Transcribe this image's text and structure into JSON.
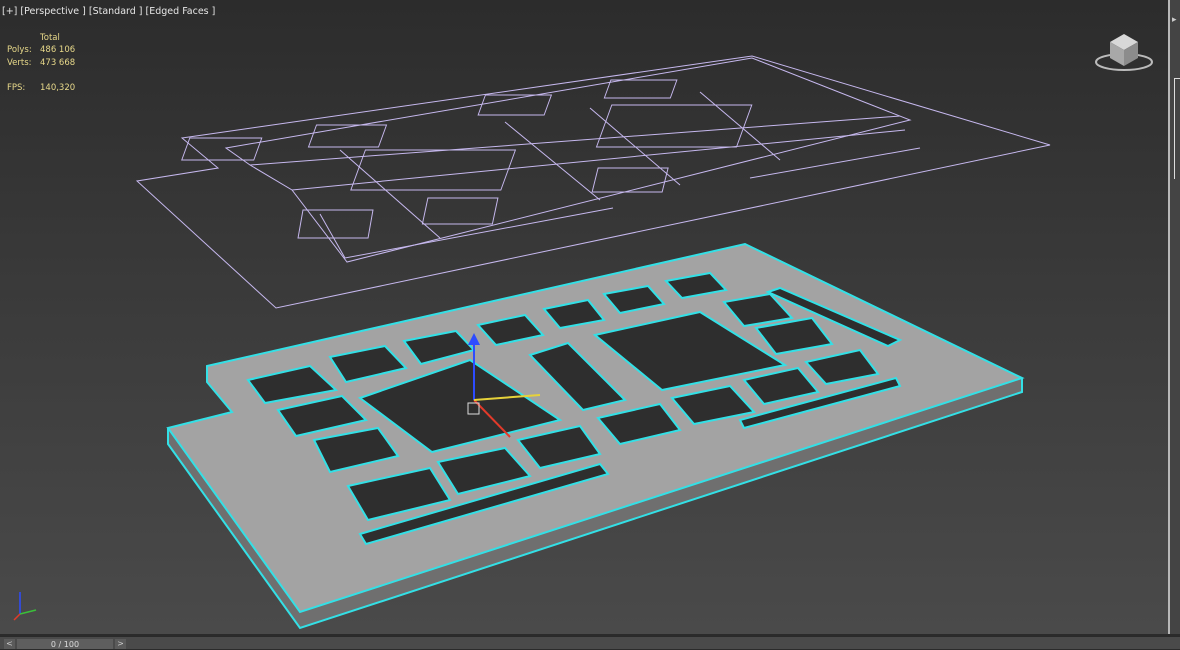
{
  "viewport": {
    "label": "[+] [Perspective ] [Standard ] [Edged Faces ]"
  },
  "stats": {
    "header": "Total",
    "polys_label": "Polys:",
    "polys_value": "486 106",
    "verts_label": "Verts:",
    "verts_value": "473 668",
    "fps_label": "FPS:",
    "fps_value": "140,320"
  },
  "timeline": {
    "prev": "<",
    "next": ">",
    "slider_text": "0 / 100"
  },
  "colors": {
    "selection_edge": "#33e0e6",
    "wire": "#c6b8ee",
    "mesh_face": "#a3a3a3"
  }
}
